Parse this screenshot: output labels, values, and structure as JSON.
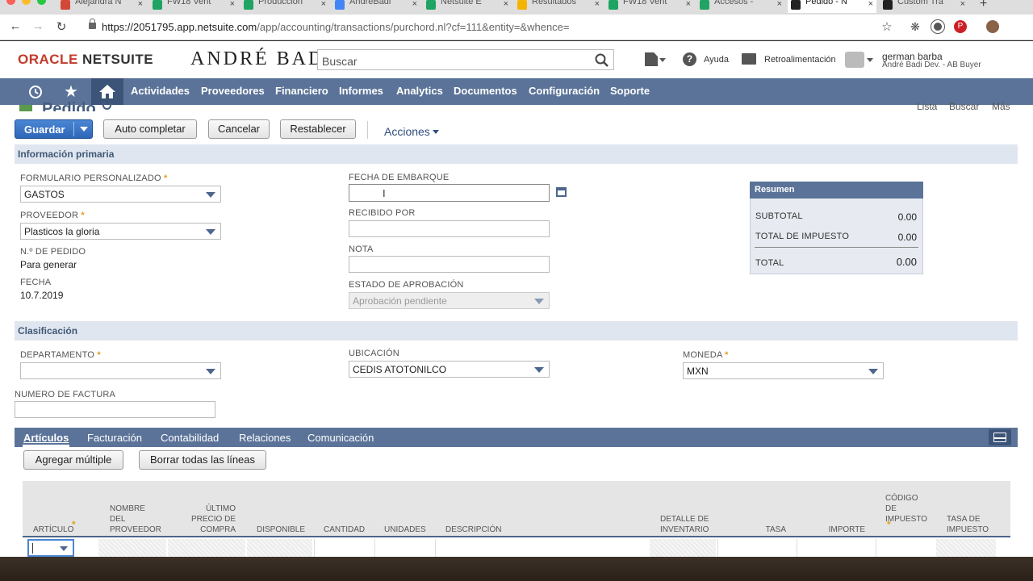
{
  "browser": {
    "tabs": [
      {
        "title": "Alejandra N",
        "fav": "gmail-icon",
        "color": "#d44638"
      },
      {
        "title": "FW18 Vent",
        "fav": "sheets-icon",
        "color": "#1fa463"
      },
      {
        "title": "Produccion",
        "fav": "sheets-icon",
        "color": "#1fa463"
      },
      {
        "title": "AndreBadi",
        "fav": "calendar-icon",
        "color": "#4285f4"
      },
      {
        "title": "Netsuite E",
        "fav": "sheets-icon",
        "color": "#1fa463"
      },
      {
        "title": "Resultados",
        "fav": "drive-icon",
        "color": "#f4b400"
      },
      {
        "title": "FW18 Vent",
        "fav": "sheets-icon",
        "color": "#1fa463"
      },
      {
        "title": "Accesos - ",
        "fav": "sheets-icon",
        "color": "#1fa463"
      },
      {
        "title": "Pedido - N",
        "fav": "netsuite-icon",
        "color": "#222222"
      },
      {
        "title": "Custom Tra",
        "fav": "netsuite-icon",
        "color": "#222222"
      }
    ],
    "url_host": "https://2051795.app.netsuite.com",
    "url_path": "/app/accounting/transactions/purchord.nl?cf=111&entity=&whence="
  },
  "header": {
    "oracle": "ORACLE",
    "netsuite": "NETSUITE",
    "brand": "ANDRÉ BADI",
    "search_placeholder": "Buscar",
    "help": "Ayuda",
    "feedback": "Retroalimentación",
    "user_name": "german barba",
    "user_role": "André Badi Dev. - AB Buyer"
  },
  "nav": [
    "Actividades",
    "Proveedores",
    "Financiero",
    "Informes",
    "Analytics",
    "Documentos",
    "Configuración",
    "Soporte"
  ],
  "page": {
    "title": "Pedido",
    "top_links": [
      "Lista",
      "Buscar",
      "Más"
    ],
    "buttons": {
      "save": "Guardar",
      "autocomplete": "Auto completar",
      "cancel": "Cancelar",
      "reset": "Restablecer",
      "actions": "Acciones"
    },
    "primary": {
      "section": "Información primaria",
      "form_label": "FORMULARIO PERSONALIZADO",
      "form_value": "GASTOS",
      "vendor_label": "PROVEEDOR",
      "vendor_value": "Plasticos la gloria",
      "po_label": "N.º DE PEDIDO",
      "po_value": "Para generar",
      "date_label": "FECHA",
      "date_value": "10.7.2019",
      "ship_label": "FECHA DE EMBARQUE",
      "received_label": "RECIBIDO POR",
      "note_label": "NOTA",
      "approval_label": "ESTADO DE APROBACIÓN",
      "approval_value": "Aprobación pendiente"
    },
    "summary": {
      "title": "Resumen",
      "subtotal_label": "SUBTOTAL",
      "subtotal": "0.00",
      "tax_label": "TOTAL DE IMPUESTO",
      "tax": "0.00",
      "total_label": "TOTAL",
      "total": "0.00"
    },
    "classification": {
      "section": "Clasificación",
      "dept_label": "DEPARTAMENTO",
      "location_label": "UBICACIÓN",
      "location_value": "CEDIS ATOTONILCO",
      "currency_label": "MONEDA",
      "currency_value": "MXN",
      "invoice_label": "NUMERO DE FACTURA"
    },
    "subtabs": [
      "Artículos",
      "Facturación",
      "Contabilidad",
      "Relaciones",
      "Comunicación"
    ],
    "line_buttons": {
      "add_multiple": "Agregar múltiple",
      "clear_lines": "Borrar todas las líneas"
    },
    "columns": [
      "ARTÍCULO",
      "NOMBRE DEL PROVEEDOR",
      "ÚLTIMO PRECIO DE COMPRA",
      "DISPONIBLE",
      "CANTIDAD",
      "UNIDADES",
      "DESCRIPCIÓN",
      "DETALLE DE INVENTARIO",
      "TASA",
      "IMPORTE",
      "CÓDIGO DE IMPUESTO",
      "TASA DE IMPUESTO"
    ]
  }
}
